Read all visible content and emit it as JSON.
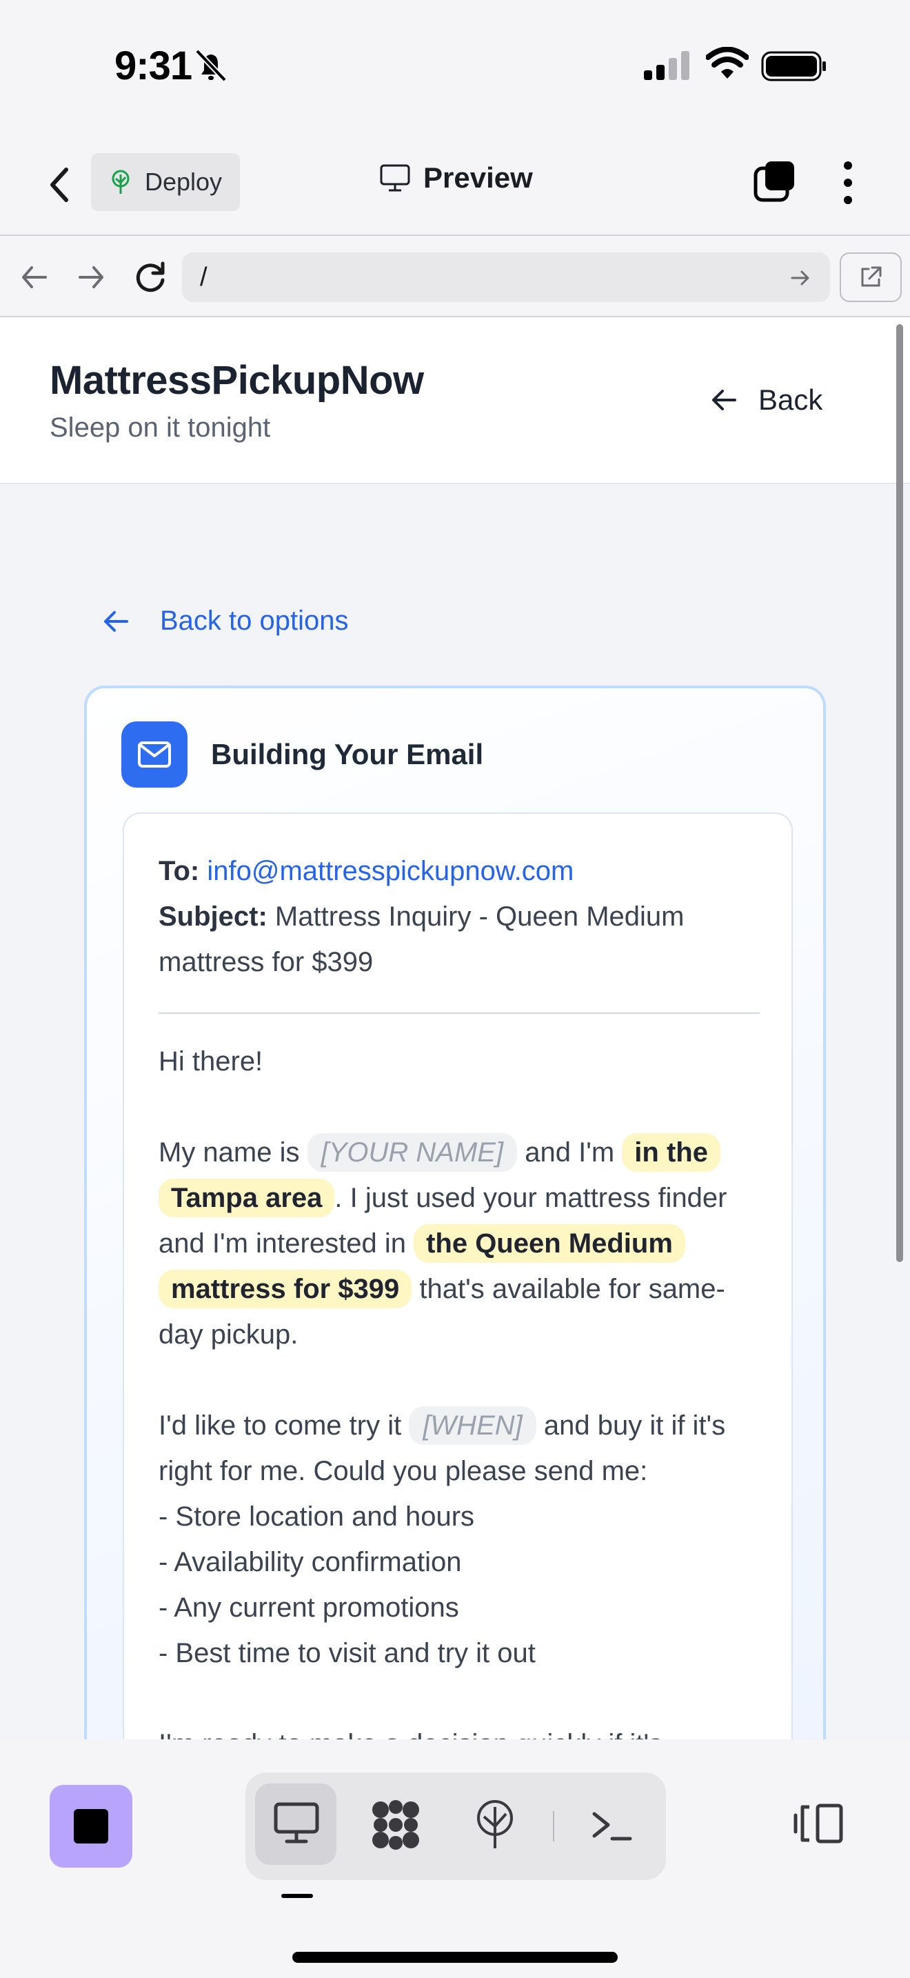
{
  "status": {
    "time": "9:31"
  },
  "toolbar": {
    "deploy_label": "Deploy",
    "preview_label": "Preview"
  },
  "browser": {
    "url": "/"
  },
  "site": {
    "title": "MattressPickupNow",
    "tagline": "Sleep on it tonight",
    "back_label": "Back"
  },
  "back_to_options": "Back to options",
  "card": {
    "title": "Building Your Email",
    "to_label": "To:",
    "to_value": "info@mattresspickupnow.com",
    "subject_label": "Subject:",
    "subject_value": "Mattress Inquiry - Queen Medium mattress for $399",
    "greeting": "Hi there!",
    "p1_a": "My name is",
    "p1_name_placeholder": "[YOUR NAME]",
    "p1_b": "and I'm",
    "p1_location": "in the Tampa area",
    "p1_c": ". I just used your mattress finder and I'm interested in",
    "p1_product": "the Queen Medium mattress for $399",
    "p1_d": "that's available for same-day pickup.",
    "p2_a": "I'd like to come try it",
    "p2_when_placeholder": "[WHEN]",
    "p2_b": "and buy it if it's right for me. Could you please send me:",
    "list": [
      "- Store location and hours",
      "- Availability confirmation",
      "- Any current promotions",
      "- Best time to visit and try it out"
    ],
    "p3": "I'm ready to make a decision quickly if it's"
  },
  "colors": {
    "accent": "#2563eb",
    "highlight": "#fef6c3",
    "stop_button": "#b9a4fb",
    "card_border": "#bfdbfe"
  }
}
